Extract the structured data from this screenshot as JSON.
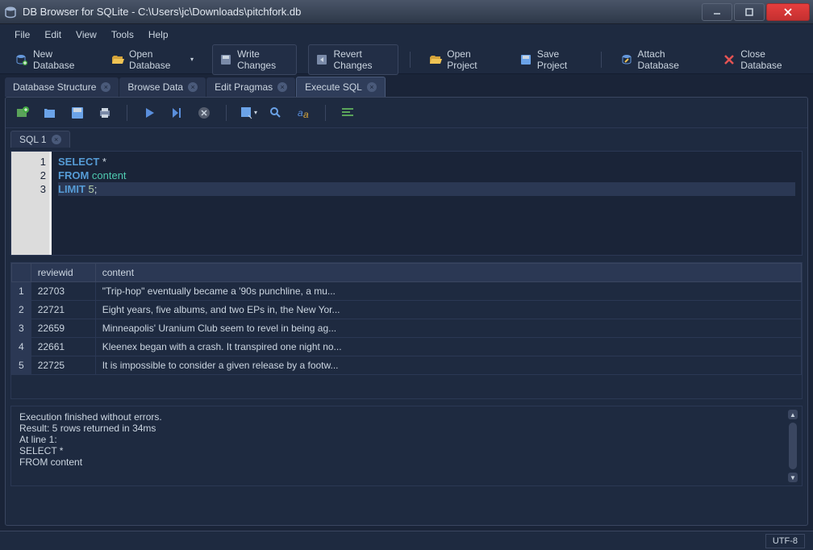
{
  "title": "DB Browser for SQLite - C:\\Users\\jc\\Downloads\\pitchfork.db",
  "menu": [
    "File",
    "Edit",
    "View",
    "Tools",
    "Help"
  ],
  "toolbar_main": {
    "new_db": "New Database",
    "open_db": "Open Database",
    "write_changes": "Write Changes",
    "revert_changes": "Revert Changes",
    "open_project": "Open Project",
    "save_project": "Save Project",
    "attach_db": "Attach Database",
    "close_db": "Close Database"
  },
  "tabs1": [
    {
      "label": "Database Structure"
    },
    {
      "label": "Browse Data"
    },
    {
      "label": "Edit Pragmas"
    },
    {
      "label": "Execute SQL",
      "active": true
    }
  ],
  "tabs2": [
    {
      "label": "SQL 1"
    }
  ],
  "sql": {
    "lines": [
      "1",
      "2",
      "3"
    ],
    "kw_select": "SELECT",
    "star": " *",
    "kw_from": "FROM",
    "ident_content": " content",
    "kw_limit": "LIMIT",
    "num_5": " 5",
    "semi": ";"
  },
  "results": {
    "headers": [
      "",
      "reviewid",
      "content"
    ],
    "rows": [
      {
        "n": "1",
        "reviewid": "22703",
        "content": "\"Trip-hop\" eventually became a '90s punchline, a mu..."
      },
      {
        "n": "2",
        "reviewid": "22721",
        "content": "Eight years, five albums, and two EPs in, the New Yor..."
      },
      {
        "n": "3",
        "reviewid": "22659",
        "content": "Minneapolis' Uranium Club seem to revel in being ag..."
      },
      {
        "n": "4",
        "reviewid": "22661",
        "content": "Kleenex began with a crash. It transpired one night no..."
      },
      {
        "n": "5",
        "reviewid": "22725",
        "content": "It is impossible to consider a given release by a footw..."
      }
    ]
  },
  "log": {
    "l1": "Execution finished without errors.",
    "l2": "Result: 5 rows returned in 34ms",
    "l3": "At line 1:",
    "l4": "SELECT *",
    "l5": "FROM content"
  },
  "status": {
    "encoding": "UTF-8"
  }
}
